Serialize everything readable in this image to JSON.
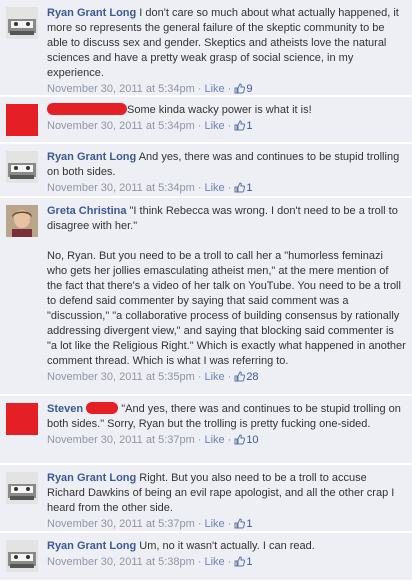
{
  "comments": [
    {
      "author": "Ryan Grant Long",
      "text": "I don't care so much about what actually happened, it more so represents the general failure of the skeptic community to be able to discuss sex and gender. Skeptics and atheists love the natural sciences and have a pretty weak grasp of social science, in my experience.",
      "timestamp": "November 30, 2011 at 5:34pm",
      "like_label": "Like",
      "likes": "9"
    },
    {
      "author": "",
      "text": "Some kinda wacky power is what it is!",
      "timestamp": "November 30, 2011 at 5:34pm",
      "like_label": "Like",
      "likes": "1"
    },
    {
      "author": "Ryan Grant Long",
      "text": "And yes, there was and continues to be stupid trolling on both sides.",
      "timestamp": "November 30, 2011 at 5:34pm",
      "like_label": "Like",
      "likes": "1"
    },
    {
      "author": "Greta Christina",
      "text": "\"I think Rebecca was wrong. I don't need to be a troll to disagree with her.\"",
      "text2": "No, Ryan. But you need to be a troll to call her a \"humorless feminazi who gets her jollies emasculating atheist men,\" at the mere mention of the fact that there's a video of her talk on YouTube. You need to be a troll to defend said commenter by saying that said comment was a \"discussion,\" \"a collaborative process of building consensus by rationally addressing divergent view,\" and saying that blocking said commenter is \"a lot like the Religious Right.\" Which is exactly what happened in another comment thread. Which is what I was referring to.",
      "timestamp": "November 30, 2011 at 5:35pm",
      "like_label": "Like",
      "likes": "28"
    },
    {
      "author": "Steven",
      "text": "\"And yes, there was and continues to be stupid trolling on both sides.\" Sorry, Ryan but the trolling is pretty fucking one-sided.",
      "timestamp": "November 30, 2011 at 5:37pm",
      "like_label": "Like",
      "likes": "10"
    },
    {
      "author": "Ryan Grant Long",
      "text": "Right. But you also need to be a troll to accuse Richard Dawkins of being an evil rape apologist, and all the other crap I heard from the other side.",
      "timestamp": "November 30, 2011 at 5:37pm",
      "like_label": "Like",
      "likes": "1"
    },
    {
      "author": "Ryan Grant Long",
      "text": "Um, no it wasn't actually. I can read.",
      "timestamp": "November 30, 2011 at 5:38pm",
      "like_label": "Like",
      "likes": "1"
    }
  ],
  "separator": "·",
  "colors": {
    "background": "#edeff4",
    "author_link": "#3b5998",
    "meta_text": "#8f96a3",
    "redaction": "#e41f25"
  }
}
